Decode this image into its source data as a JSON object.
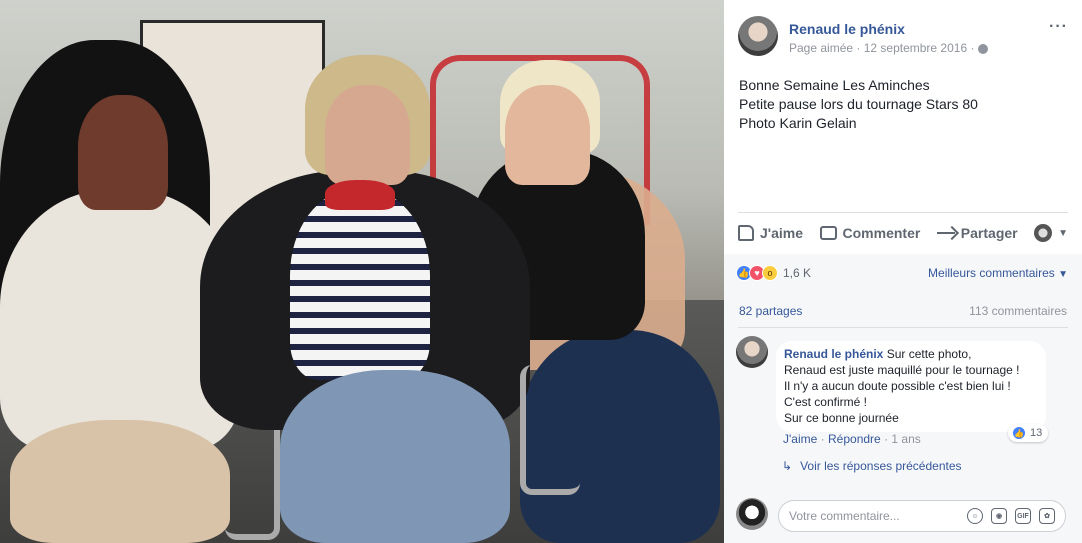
{
  "post": {
    "author": "Renaud le phénix",
    "meta": "Page aimée · 12 septembre 2016 ·",
    "more": "···",
    "text": [
      "Bonne Semaine Les Aminches",
      "Petite pause lors du tournage Stars 80",
      "Photo Karin Gelain"
    ]
  },
  "actions": {
    "like": "J'aime",
    "comment": "Commenter",
    "share": "Partager",
    "caret": "▼"
  },
  "reactions": {
    "count": "1,6 K",
    "best_label": "Meilleurs commentaires",
    "best_caret": "▼"
  },
  "stats": {
    "shares": "82 partages",
    "comments": "113 commentaires"
  },
  "comment": {
    "author": "Renaud le phénix",
    "lines": [
      "Sur cette photo,",
      "Renaud est juste maquillé pour le tournage !",
      "Il n'y a aucun doute possible c'est bien lui !",
      "C'est confirmé !",
      "Sur ce bonne journée"
    ],
    "like_count": "13",
    "like_label": "J'aime",
    "reply_label": "Répondre",
    "time": "1 ans",
    "separator": "·"
  },
  "replies": {
    "label": "Voir les réponses précédentes"
  },
  "composer": {
    "placeholder": "Votre commentaire...",
    "gif": "GIF"
  }
}
